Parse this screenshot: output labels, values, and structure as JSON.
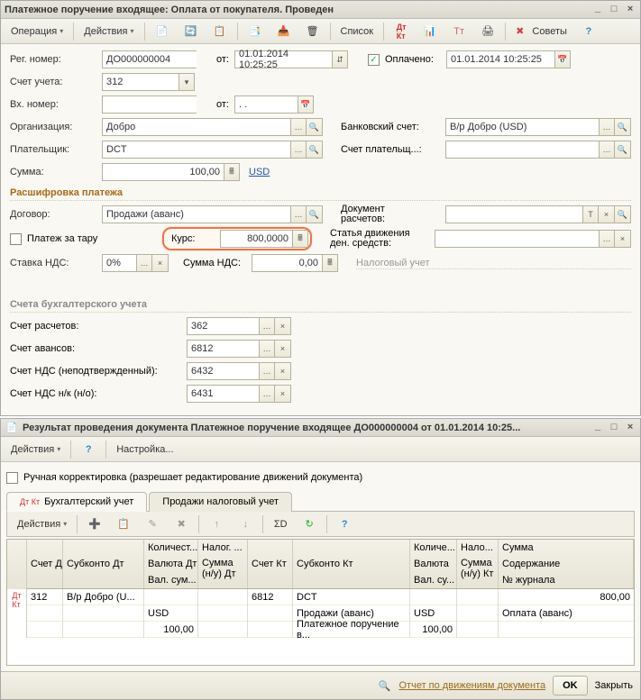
{
  "window1": {
    "title": "Платежное поручение входящее: Оплата от покупателя. Проведен",
    "toolbar": {
      "operation": "Операция",
      "actions": "Действия",
      "list": "Список",
      "tips": "Советы"
    },
    "fields": {
      "reg_number_label": "Рег. номер:",
      "reg_number": "ДО000000004",
      "from_label": "от:",
      "reg_date": "01.01.2014 10:25:25",
      "paid_label": "Оплачено:",
      "paid_date": "01.01.2014 10:25:25",
      "account_label": "Счет учета:",
      "account": "312",
      "in_number_label": "Вх. номер:",
      "in_number": "",
      "in_date": ". .",
      "org_label": "Организация:",
      "org": "Добро",
      "bank_acct_label": "Банковский счет:",
      "bank_acct": "В/р Добро (USD)",
      "payer_label": "Плательщик:",
      "payer": "DCT",
      "payer_acct_label": "Счет плательщ...:",
      "payer_acct": "",
      "sum_label": "Сумма:",
      "sum_value": "100,00",
      "currency": "USD"
    },
    "breakdown": {
      "title": "Расшифровка платежа",
      "contract_label": "Договор:",
      "contract": "Продажи (аванс)",
      "doc_calc_label1": "Документ",
      "doc_calc_label2": "расчетов:",
      "tara_label": "Платеж за тару",
      "rate_label": "Курс:",
      "rate_value": "800,0000",
      "flow_label1": "Статья движения",
      "flow_label2": "ден. средств:",
      "vat_rate_label": "Ставка НДС:",
      "vat_rate": "0%",
      "vat_sum_label": "Сумма НДС:",
      "vat_sum": "0,00",
      "tax_accounting": "Налоговый учет"
    },
    "accounts": {
      "title": "Счета бухгалтерского учета",
      "settlement_label": "Счет расчетов:",
      "settlement": "362",
      "advance_label": "Счет авансов:",
      "advance": "6812",
      "vat_unconf_label": "Счет НДС (неподтвержденный):",
      "vat_unconf": "6432",
      "vat_nk_label": "Счет НДС н/к (н/о):",
      "vat_nk": "6431"
    }
  },
  "window2": {
    "title": "Результат проведения документа Платежное поручение входящее ДО000000004 от 01.01.2014 10:25...",
    "toolbar": {
      "actions": "Действия",
      "settings": "Настройка..."
    },
    "manual_corr": "Ручная корректировка (разрешает редактирование движений документа)",
    "tabs": {
      "acc": "Бухгалтерский учет",
      "tax": "Продажи налоговый учет"
    },
    "grid": {
      "actions": "Действия",
      "headers": {
        "acct_dt": "Счет Дт",
        "subconto_dt": "Субконто Дт",
        "qty": "Количест...",
        "cur_dt": "Валюта Дт",
        "valsum": "Вал. сум...",
        "tax": "Налог. ...",
        "sum_nu_dt1": "Сумма",
        "sum_nu_dt2": "(н/у) Дт",
        "acct_kt": "Счет Кт",
        "subconto_kt": "Субконто Кт",
        "qty2": "Количе...",
        "cur_kt": "Валюта",
        "valsum2": "Вал. су...",
        "tax2": "Нало...",
        "sum_nu_kt1": "Сумма",
        "sum_nu_kt2": "(н/у) Кт",
        "sum": "Сумма",
        "content": "Содержание",
        "journal": "№ журнала"
      },
      "row": {
        "acct_dt": "312",
        "subconto_dt": "В/р Добро (U...",
        "cur_dt": "USD",
        "valsum_dt": "100,00",
        "acct_kt": "6812",
        "subconto_kt1": "DCT",
        "subconto_kt2": "Продажи (аванс)",
        "subconto_kt3": "Платежное поручение в...",
        "cur_kt": "USD",
        "valsum_kt": "100,00",
        "sum": "800,00",
        "content": "Оплата (аванс)"
      }
    },
    "footer": {
      "report": "Отчет по движениям документа",
      "ok": "OK",
      "close": "Закрыть"
    }
  }
}
